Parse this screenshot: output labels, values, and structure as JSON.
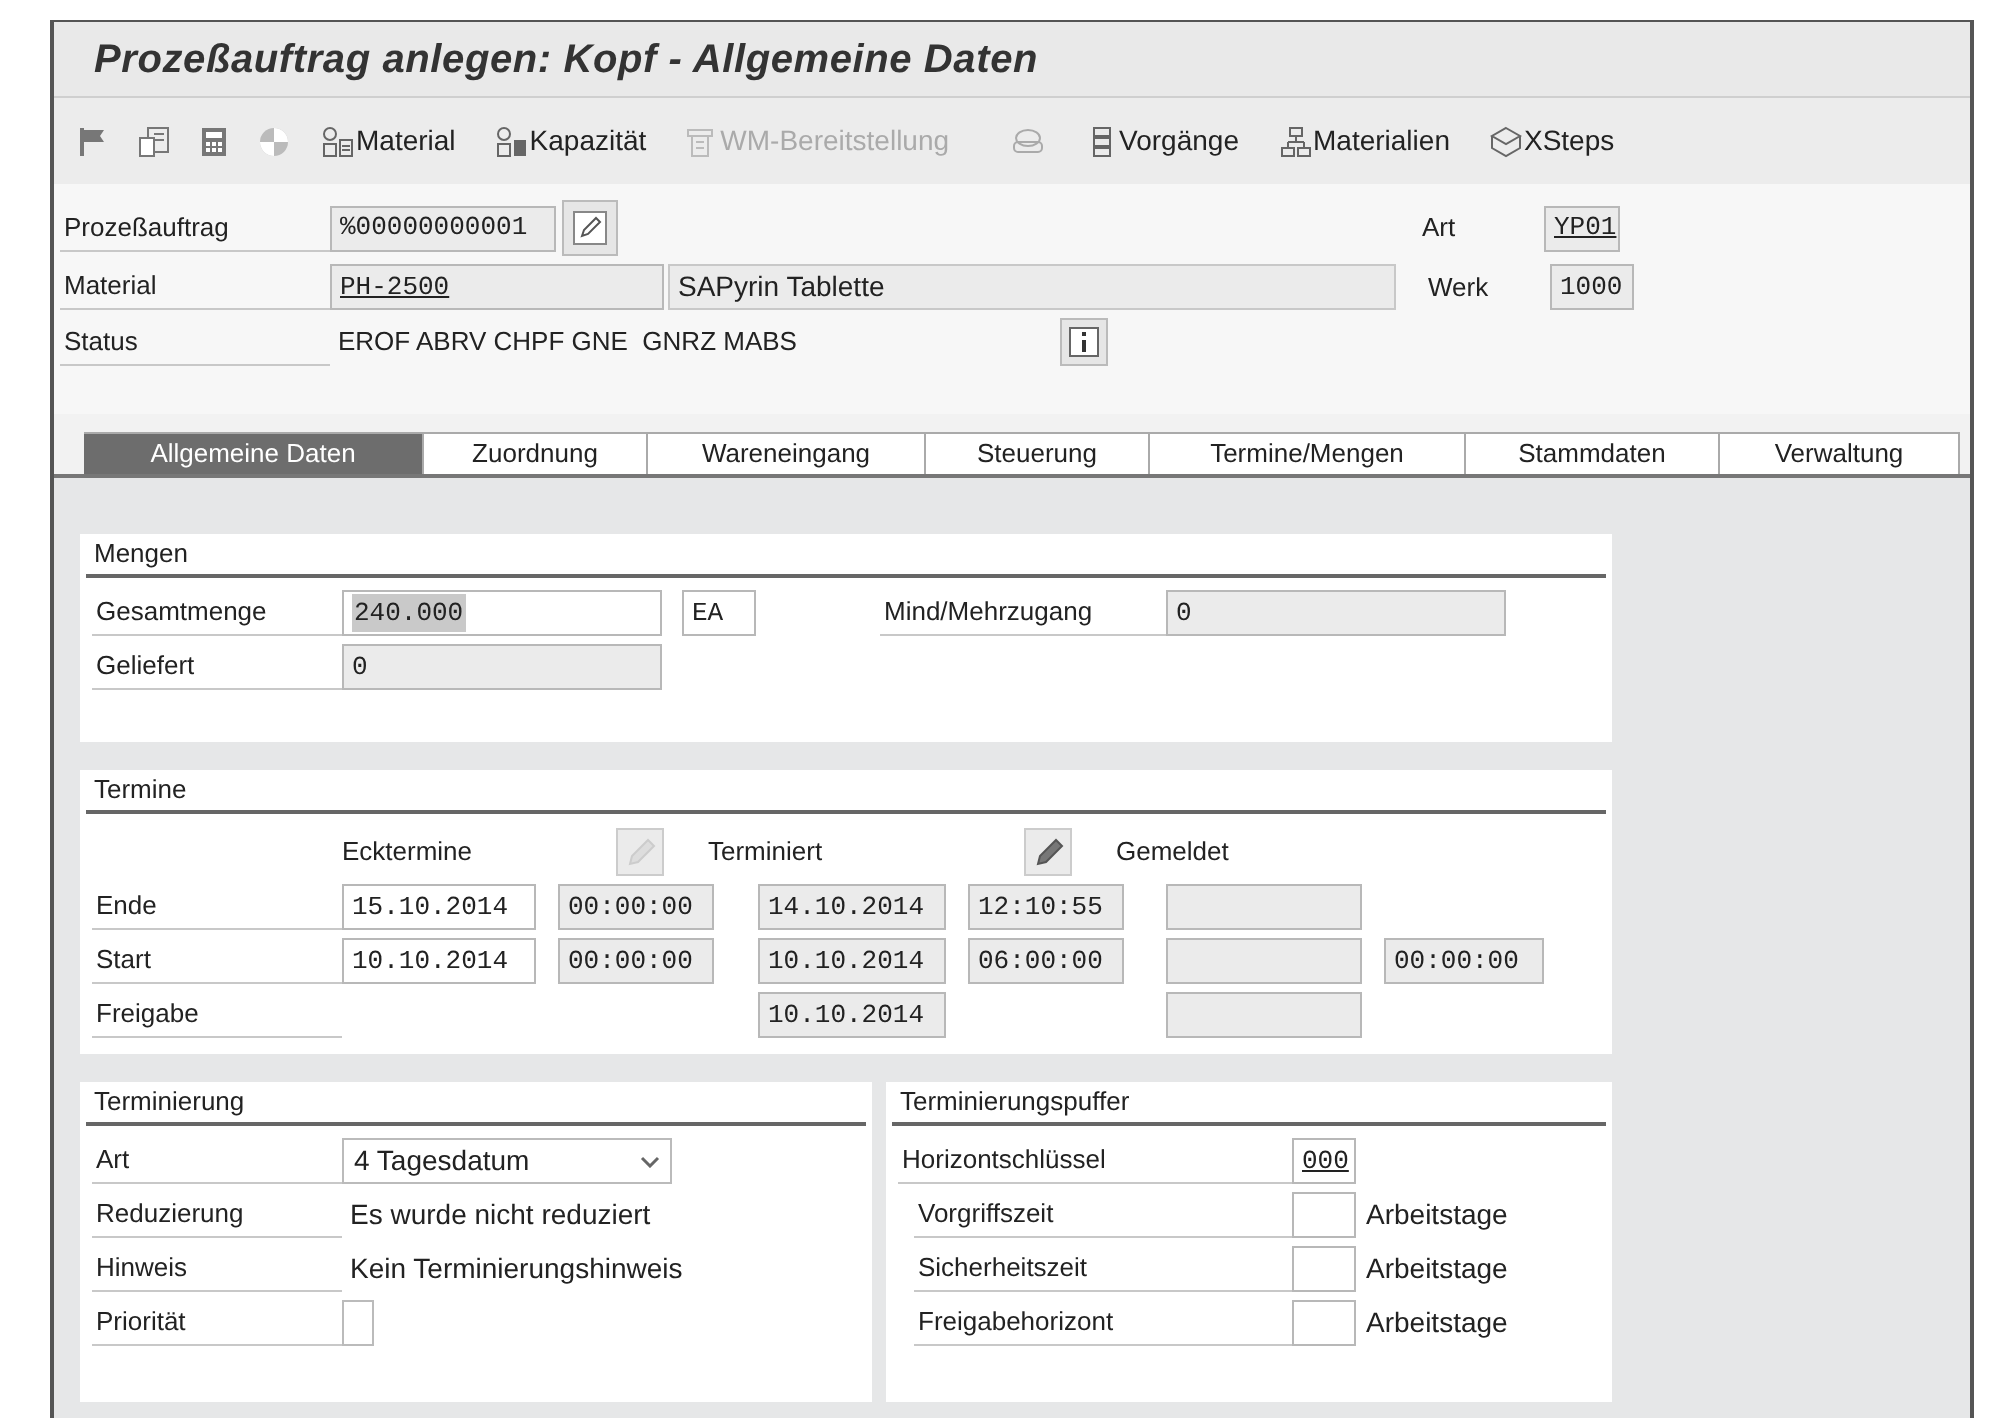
{
  "window": {
    "title": "Prozeßauftrag anlegen: Kopf - Allgemeine Daten"
  },
  "toolbar": [
    {
      "label": "Material",
      "disabled": false
    },
    {
      "label": "Kapazität",
      "disabled": false
    },
    {
      "label": "WM-Bereitstellung",
      "disabled": true
    },
    {
      "label": "Vorgänge",
      "disabled": false
    },
    {
      "label": "Materialien",
      "disabled": false
    },
    {
      "label": "XSteps",
      "disabled": false
    }
  ],
  "header": {
    "order": {
      "label": "Prozeßauftrag",
      "value": "%00000000001"
    },
    "type": {
      "label": "Art",
      "value": "YP01"
    },
    "material": {
      "label": "Material",
      "value": "PH-2500",
      "description": "SAPyrin Tablette"
    },
    "plant": {
      "label": "Werk",
      "value": "1000"
    },
    "status": {
      "label": "Status",
      "value": "EROF ABRV CHPF GNE  GNRZ MABS"
    }
  },
  "tabs": [
    {
      "label": "Allgemeine Daten",
      "selected": true
    },
    {
      "label": "Zuordnung",
      "selected": false
    },
    {
      "label": "Wareneingang",
      "selected": false
    },
    {
      "label": "Steuerung",
      "selected": false
    },
    {
      "label": "Termine/Mengen",
      "selected": false
    },
    {
      "label": "Stammdaten",
      "selected": false
    },
    {
      "label": "Verwaltung",
      "selected": false
    }
  ],
  "quantities": {
    "title": "Mengen",
    "total": {
      "label": "Gesamtmenge",
      "value": "240.000",
      "unit": "EA"
    },
    "over_under": {
      "label": "Mind/Mehrzugang",
      "value": "0"
    },
    "delivered": {
      "label": "Geliefert",
      "value": "0"
    }
  },
  "dates": {
    "title": "Termine",
    "columns": [
      {
        "label": "Ecktermine",
        "edit_enabled": false
      },
      {
        "label": "Terminiert",
        "edit_enabled": true
      },
      {
        "label": "Gemeldet"
      }
    ],
    "rows": [
      {
        "label": "Ende",
        "basic_date": {
          "kind": "input",
          "value": "15.10.2014"
        },
        "basic_time": {
          "kind": "display",
          "value": "00:00:00"
        },
        "sched_date": {
          "kind": "display",
          "value": "14.10.2014"
        },
        "sched_time": {
          "kind": "display",
          "value": "12:10:55"
        },
        "confirmed_date": {
          "kind": "display"
        }
      },
      {
        "label": "Start",
        "basic_date": {
          "kind": "input",
          "value": "10.10.2014"
        },
        "basic_time": {
          "kind": "display",
          "value": "00:00:00"
        },
        "sched_date": {
          "kind": "display",
          "value": "10.10.2014"
        },
        "sched_time": {
          "kind": "display",
          "value": "06:00:00"
        },
        "confirmed_date": {
          "kind": "display"
        },
        "confirmed_time": {
          "kind": "display",
          "value": "00:00:00"
        }
      },
      {
        "label": "Freigabe",
        "sched_date": {
          "kind": "display",
          "value": "10.10.2014"
        },
        "confirmed_date": {
          "kind": "display"
        }
      }
    ]
  },
  "scheduling": {
    "title": "Terminierung",
    "rows": [
      {
        "kind": "dropdown",
        "label": "Art",
        "value": "4 Tagesdatum"
      },
      {
        "kind": "text",
        "label": "Reduzierung",
        "value": "Es wurde nicht reduziert"
      },
      {
        "kind": "text",
        "label": "Hinweis",
        "value": "Kein Terminierungshinweis"
      },
      {
        "kind": "small_input",
        "label": "Priorität"
      }
    ]
  },
  "float": {
    "title": "Terminierungspuffer",
    "key": {
      "label": "Horizontschlüssel",
      "value": "000"
    },
    "rows": [
      {
        "label": "Vorgriffszeit",
        "unit": "Arbeitstage"
      },
      {
        "label": "Sicherheitszeit",
        "unit": "Arbeitstage"
      },
      {
        "label": "Freigabehorizont",
        "unit": "Arbeitstage"
      }
    ]
  }
}
